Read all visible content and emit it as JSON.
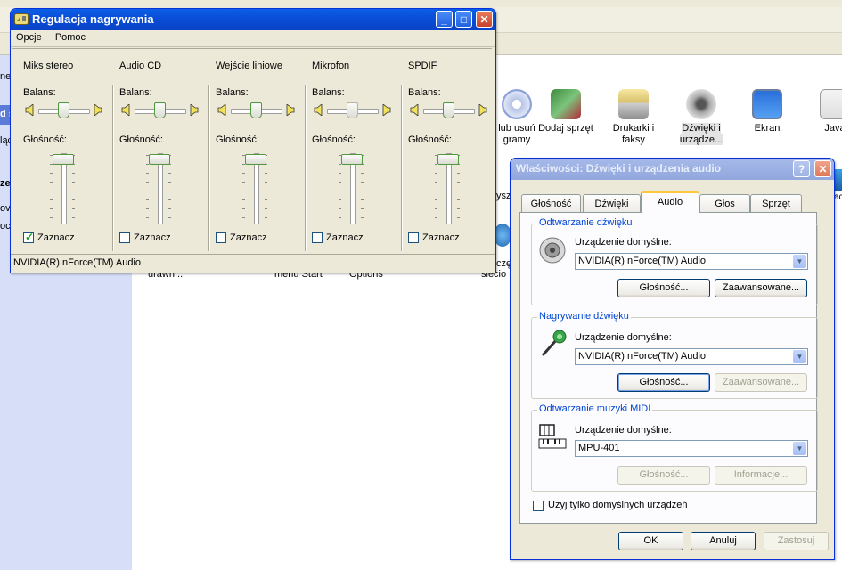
{
  "background": {
    "icons": [
      {
        "label": "lub usuń\ngramy"
      },
      {
        "label": "Dodaj sprzęt"
      },
      {
        "label": "Drukarki i\nfaksy"
      },
      {
        "label": "Dźwięki i\nurządze..."
      },
      {
        "label": "Ekran"
      },
      {
        "label": "Java"
      }
    ],
    "fragments": {
      "f1": "ne",
      "f2": "d s",
      "f3": "ląc",
      "f4": "ze",
      "f5": "ov",
      "f6": "oc",
      "f7": "ysz",
      "f8": "czę",
      "f9": "siecio",
      "f10": "urawn...",
      "f11": "menu Start",
      "f12": "Options",
      "f13": "acje"
    }
  },
  "mixer": {
    "title": "Regulacja nagrywania",
    "menu": [
      "Opcje",
      "Pomoc"
    ],
    "balance_label": "Balans:",
    "volume_label": "Głośność:",
    "select_label": "Zaznacz",
    "channels": [
      {
        "name": "Miks stereo",
        "checked": true
      },
      {
        "name": "Audio CD",
        "checked": false
      },
      {
        "name": "Wejście liniowe",
        "checked": false
      },
      {
        "name": "Mikrofon",
        "checked": false
      },
      {
        "name": "SPDIF",
        "checked": false
      }
    ],
    "status": "NVIDIA(R) nForce(TM) Audio"
  },
  "props": {
    "title": "Właściwości: Dźwięki i urządzenia audio",
    "tabs": [
      "Głośność",
      "Dźwięki",
      "Audio",
      "Głos",
      "Sprzęt"
    ],
    "active_tab": "Audio",
    "playback": {
      "title": "Odtwarzanie dźwięku",
      "device_label": "Urządzenie domyślne:",
      "device_value": "NVIDIA(R) nForce(TM) Audio",
      "volume_btn": "Głośność...",
      "advanced_btn": "Zaawansowane..."
    },
    "recording": {
      "title": "Nagrywanie dźwięku",
      "device_label": "Urządzenie domyślne:",
      "device_value": "NVIDIA(R) nForce(TM) Audio",
      "volume_btn": "Głośność...",
      "advanced_btn": "Zaawansowane..."
    },
    "midi": {
      "title": "Odtwarzanie muzyki MIDI",
      "device_label": "Urządzenie domyślne:",
      "device_value": "MPU-401",
      "volume_btn": "Głośność...",
      "info_btn": "Informacje..."
    },
    "default_only": "Użyj tylko domyślnych urządzeń",
    "ok": "OK",
    "cancel": "Anuluj",
    "apply": "Zastosuj"
  }
}
